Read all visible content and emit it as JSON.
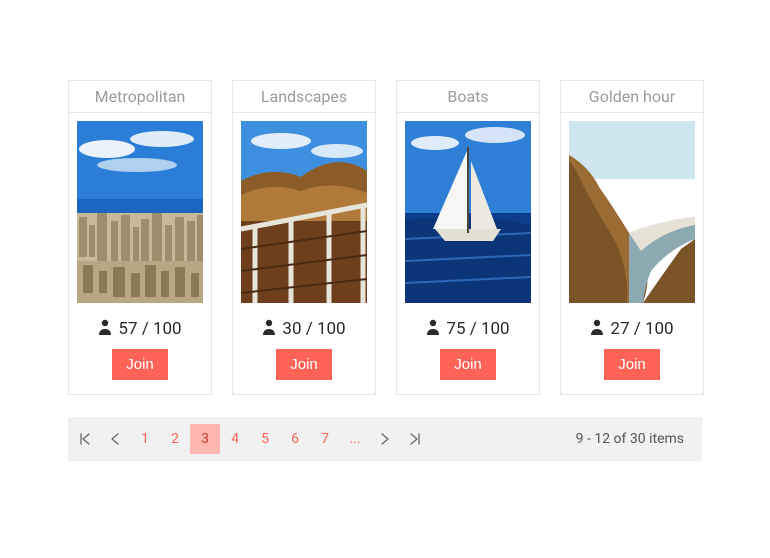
{
  "cards": [
    {
      "title": "Metropolitan",
      "count": "57 / 100",
      "join": "Join"
    },
    {
      "title": "Landscapes",
      "count": "30 / 100",
      "join": "Join"
    },
    {
      "title": "Boats",
      "count": "75 / 100",
      "join": "Join"
    },
    {
      "title": "Golden hour",
      "count": "27 / 100",
      "join": "Join"
    }
  ],
  "pager": {
    "pages": [
      "1",
      "2",
      "3",
      "4",
      "5",
      "6",
      "7"
    ],
    "current": "3",
    "ellipsis": "...",
    "info": "9 - 12 of 30 items"
  },
  "colors": {
    "accent": "#ff6358"
  }
}
